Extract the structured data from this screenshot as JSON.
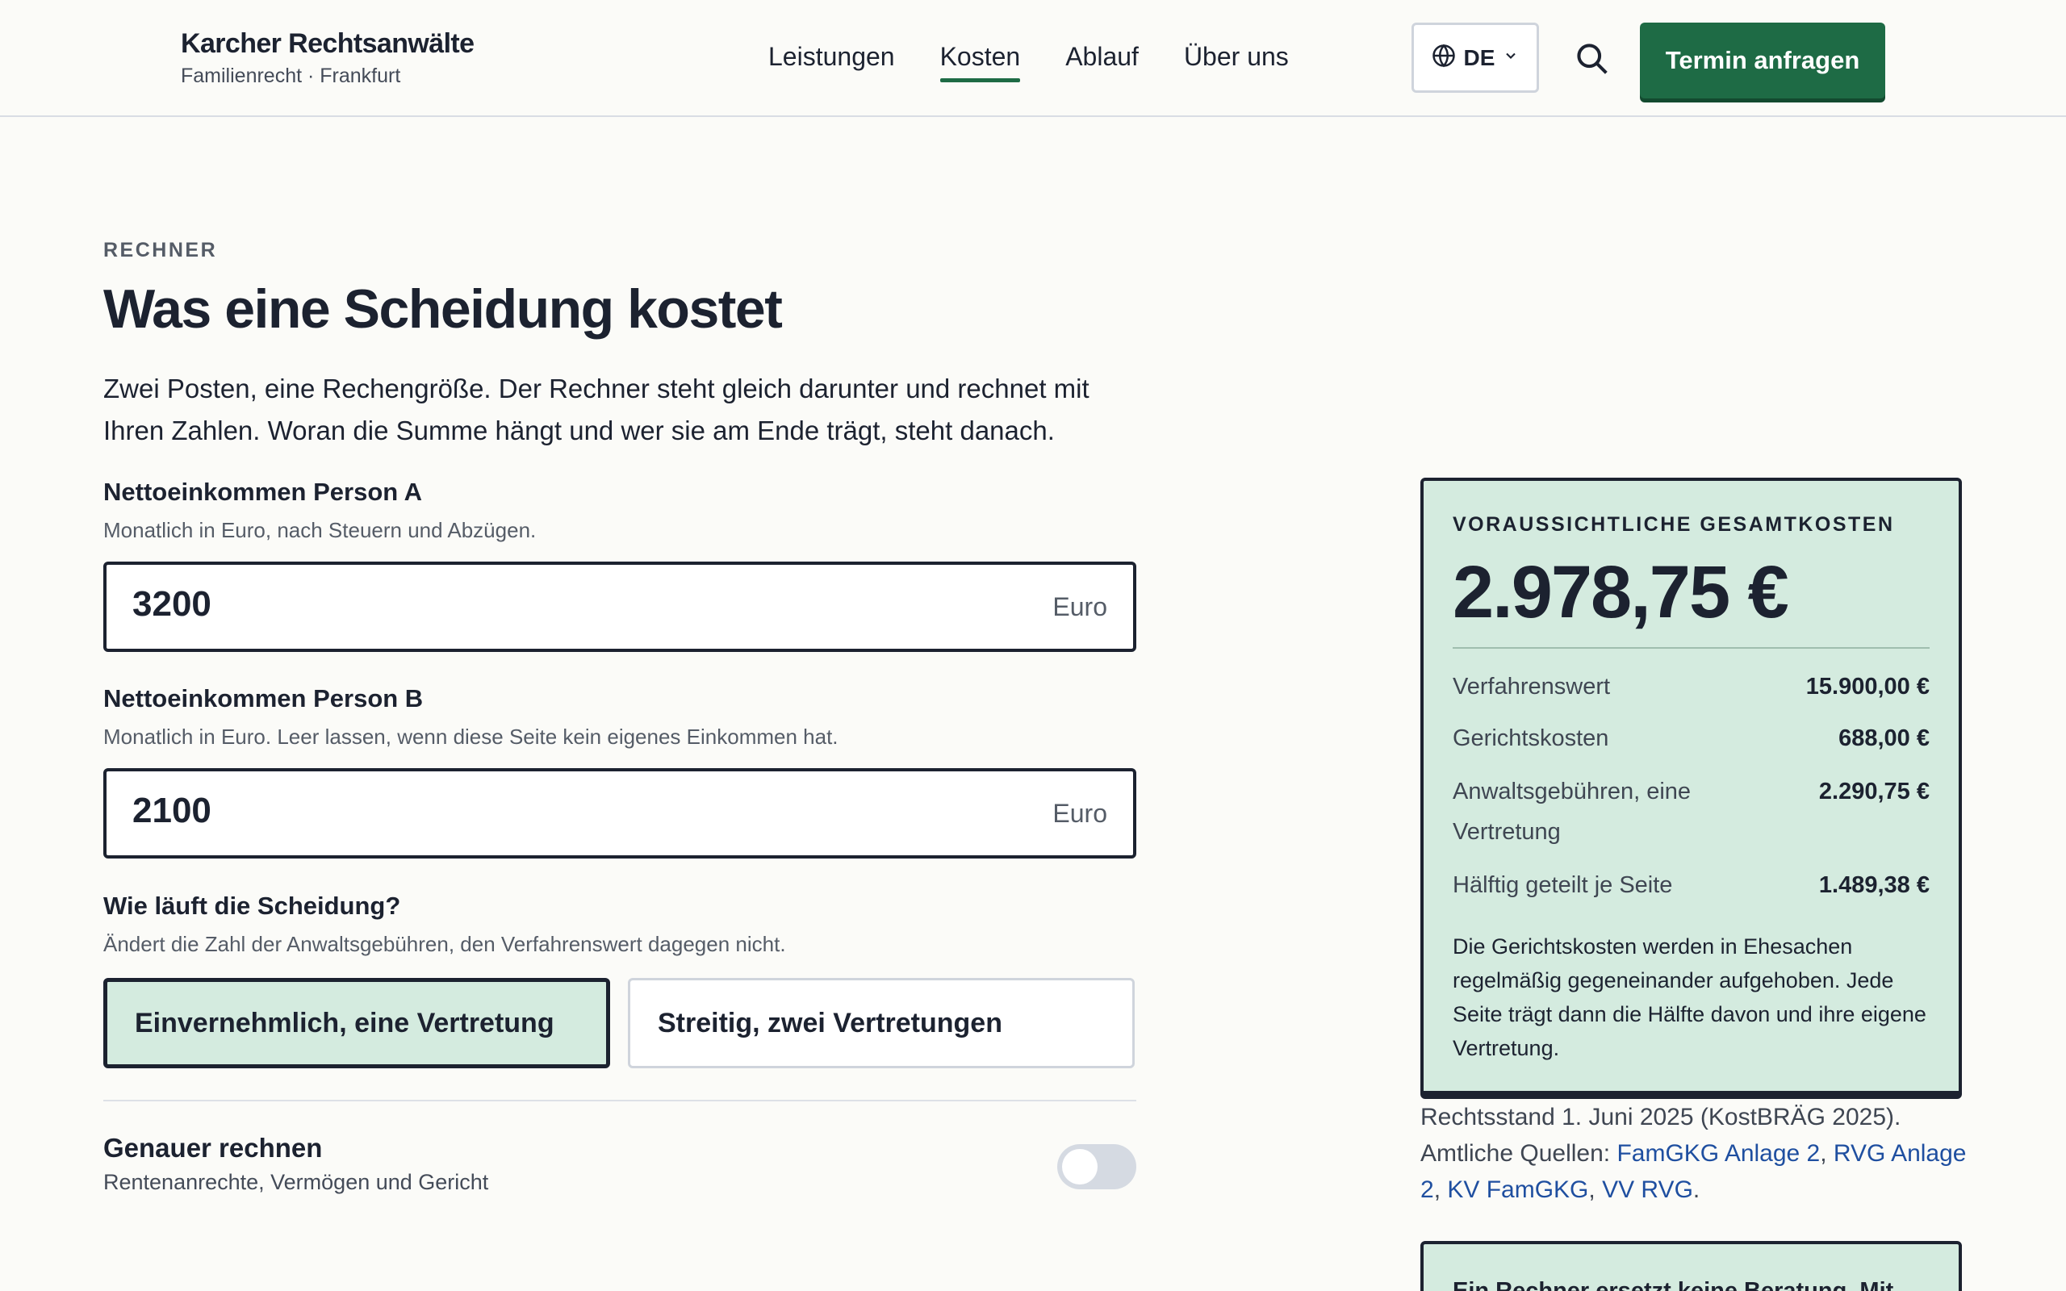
{
  "header": {
    "brand_name": "Karcher Rechtsanwälte",
    "brand_sub": "Familienrecht · Frankfurt",
    "nav": [
      "Leistungen",
      "Kosten",
      "Ablauf",
      "Über uns"
    ],
    "active_nav": "Kosten",
    "lang": "DE",
    "cta": "Termin anfragen",
    "accent": "#1e6b45"
  },
  "intro": {
    "eyebrow": "RECHNER",
    "title": "Was eine Scheidung kostet",
    "lead": "Zwei Posten, eine Rechengröße. Der Rechner steht gleich darunter und rechnet mit Ihren Zahlen. Woran die Summe hängt und wer sie am Ende trägt, steht danach."
  },
  "form": {
    "person_a": {
      "label": "Nettoeinkommen Person A",
      "help": "Monatlich in Euro, nach Steuern und Abzügen.",
      "value": "3200",
      "unit": "Euro"
    },
    "person_b": {
      "label": "Nettoeinkommen Person B",
      "help": "Monatlich in Euro. Leer lassen, wenn diese Seite kein eigenes Einkommen hat.",
      "value": "2100",
      "unit": "Euro"
    },
    "mode": {
      "label": "Wie läuft die Scheidung?",
      "help": "Ändert die Zahl der Anwaltsgebühren, den Verfahrenswert dagegen nicht.",
      "options": [
        "Einvernehmlich, eine Vertretung",
        "Streitig, zwei Vertretungen"
      ],
      "selected": "Einvernehmlich, eine Vertretung"
    },
    "detail": {
      "title": "Genauer rechnen",
      "sub": "Rentenanrechte, Vermögen und Gericht",
      "enabled": false
    }
  },
  "result": {
    "eyebrow": "VORAUSSICHTLICHE GESAMTKOSTEN",
    "total": "2.978,75 €",
    "rows": [
      {
        "label": "Verfahrenswert",
        "value": "15.900,00 €"
      },
      {
        "label": "Gerichtskosten",
        "value": "688,00 €"
      },
      {
        "label": "Anwaltsgebühren, eine Vertretung",
        "value": "2.290,75 €"
      },
      {
        "label": "Hälftig geteilt je Seite",
        "value": "1.489,38 €"
      }
    ],
    "note": "Die Gerichtskosten werden in Ehesachen regelmäßig gegeneinander aufgehoben. Jede Seite trägt dann die Hälfte davon und ihre eigene Vertretung.",
    "card_bg": "#d4ebdf"
  },
  "sources": {
    "status": "Rechtsstand 1. Juni 2025 (KostBRÄG 2025).",
    "prefix": "Amtliche Quellen:",
    "links": [
      "FamGKG Anlage 2",
      "RVG Anlage 2",
      "KV FamGKG",
      "VV RVG"
    ]
  },
  "advice_card": {
    "text": "Ein Rechner ersetzt keine Beratung. Mit"
  }
}
